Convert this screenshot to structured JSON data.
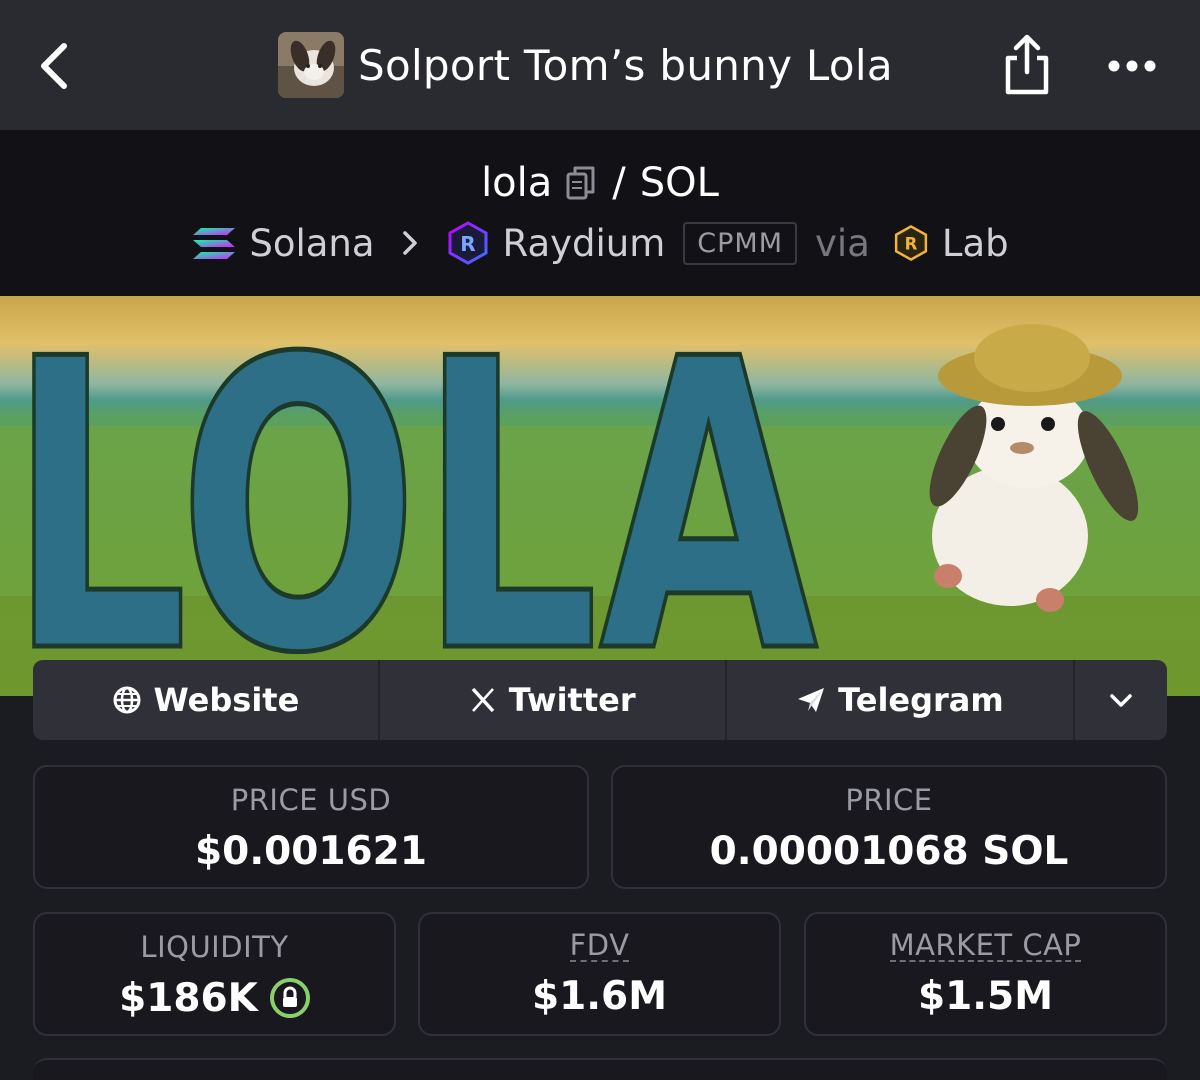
{
  "nav": {
    "title": "Solport Tom’s bunny Lola"
  },
  "pair": {
    "base": "lola",
    "separator": "/",
    "quote": "SOL"
  },
  "chain_line": {
    "chain": "Solana",
    "dex": "Raydium",
    "pool_type": "CPMM",
    "via": "via",
    "launchpad": "Lab"
  },
  "banner": {
    "text": "LOLA"
  },
  "socials": {
    "website": "Website",
    "twitter": "Twitter",
    "telegram": "Telegram"
  },
  "stats": {
    "price_usd": {
      "label": "PRICE USD",
      "value": "$0.001621"
    },
    "price": {
      "label": "PRICE",
      "value": "0.00001068 SOL"
    },
    "liquidity": {
      "label": "LIQUIDITY",
      "value": "$186K"
    },
    "fdv": {
      "label": "FDV",
      "value": "$1.6M"
    },
    "market_cap": {
      "label": "MARKET CAP",
      "value": "$1.5M"
    }
  },
  "colors": {
    "nav_bg": "#2a2a31",
    "header_bg": "#121216",
    "page_bg": "#1b1b22",
    "lock_green": "#8ad06a"
  }
}
